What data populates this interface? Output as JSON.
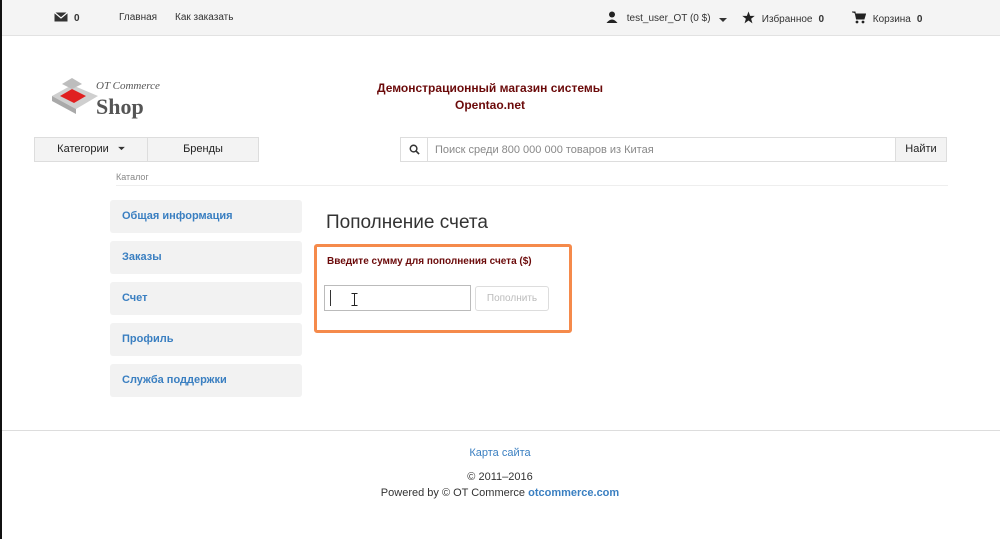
{
  "topbar": {
    "messages_count": "0",
    "nav": [
      "Главная",
      "Как заказать"
    ],
    "user": "test_user_OT (0 $)",
    "favorites_label": "Избранное",
    "favorites_count": "0",
    "cart_label": "Корзина",
    "cart_count": "0"
  },
  "header": {
    "logo_top": "OT Commerce",
    "logo_bottom": "Shop",
    "store_title_line1": "Демонстрационный магазин системы",
    "store_title_line2": "Opentao.net"
  },
  "nav": {
    "categories_label": "Категории",
    "brands_label": "Бренды",
    "search_placeholder": "Поиск среди 800 000 000 товаров из Китая",
    "search_button": "Найти"
  },
  "breadcrumb": "Каталог",
  "sidebar": {
    "items": [
      {
        "label": "Общая информация"
      },
      {
        "label": "Заказы"
      },
      {
        "label": "Счет"
      },
      {
        "label": "Профиль"
      },
      {
        "label": "Служба поддержки"
      }
    ]
  },
  "content": {
    "title": "Пополнение счета",
    "amount_label": "Введите сумму для пополнения счета ($)",
    "amount_value": "",
    "topup_button": "Пополнить"
  },
  "footer": {
    "sitemap": "Карта сайта",
    "copyright": "© 2011–2016",
    "powered_prefix": "Powered by © OT Commerce",
    "powered_link": "otcommerce.com"
  },
  "colors": {
    "accent": "#3a7fc1",
    "title_red": "#6b0a0a",
    "highlight": "#f58a4b",
    "logo_red": "#e02020"
  }
}
